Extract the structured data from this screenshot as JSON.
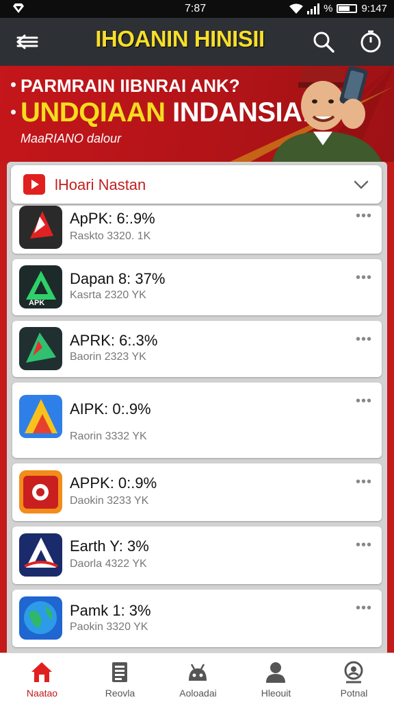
{
  "status_bar": {
    "time": "7:87",
    "signal": "%",
    "clock_right": "9:147"
  },
  "app_bar": {
    "title": "IHOANIN HINISII"
  },
  "banner": {
    "line1": "PARMRAIN IIBNRAI ANK?",
    "line2_yellow": "UNDQIAAN",
    "line2_white": "INDANSIA!",
    "line3": "MaaRIANO dalour"
  },
  "dropdown": {
    "label": "lHoari Nastan"
  },
  "apps": [
    {
      "name": "ApPK: 6:.9%",
      "meta": "Raskto 3320. 1K"
    },
    {
      "name": "Dapan 8: 37%",
      "meta": "Kasrta 2320 YK"
    },
    {
      "name": "APRK: 6:.3%",
      "meta": "Baorin 2323 YK"
    },
    {
      "name": "AIPK: 0:.9%",
      "meta": "Raorin 3332 YK"
    },
    {
      "name": "APPK: 0:.9%",
      "meta": "Daokin 3233 YK"
    },
    {
      "name": "Earth Y: 3%",
      "meta": "Daorla 4322 YK"
    },
    {
      "name": "Pamk 1: 3%",
      "meta": "Paokin 3320 YK"
    }
  ],
  "nav": [
    {
      "label": "Naatao",
      "icon": "home-icon"
    },
    {
      "label": "Reovla",
      "icon": "document-icon"
    },
    {
      "label": "Aoloadai",
      "icon": "robot-icon"
    },
    {
      "label": "Hleouit",
      "icon": "person-icon"
    },
    {
      "label": "Potnal",
      "icon": "profile-badge-icon"
    }
  ],
  "colors": {
    "accent": "#c4161b",
    "title_yellow": "#f7df2a",
    "app_bar": "#2d3035"
  }
}
